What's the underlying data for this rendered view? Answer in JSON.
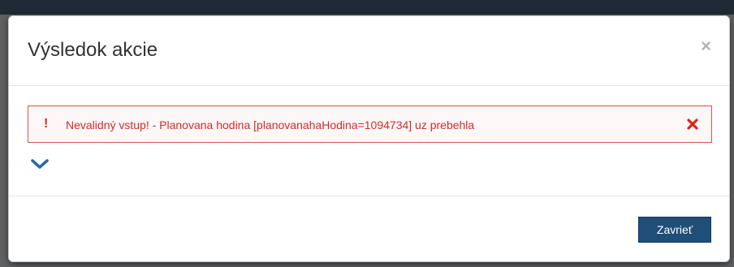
{
  "dialog": {
    "title": "Výsledok akcie",
    "close_glyph": "×"
  },
  "alert": {
    "icon": "!",
    "message": "Nevalidný vstup! - Planovana hodina [planovanahaHodina=1094734] uz prebehla",
    "color": "#c9302c"
  },
  "footer": {
    "close_label": "Zavrieť"
  },
  "icons": {
    "dismiss": "times-icon",
    "expand": "chevron-down-icon"
  }
}
